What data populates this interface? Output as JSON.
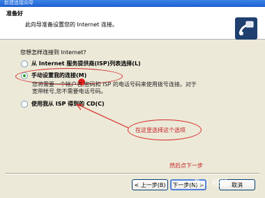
{
  "window": {
    "title": "新建连接向导"
  },
  "header": {
    "title": "准备好",
    "subtitle": "此向导准备设置您的 Internet 连接。",
    "icon": "wizard-connection-icon"
  },
  "question": "您想怎样连接到 Internet?",
  "options": [
    {
      "label": "从 Internet 服务提供商(ISP)列表选择(L)",
      "selected": false
    },
    {
      "label": "手动设置我的连接(M)",
      "selected": true
    },
    {
      "label": "使用我从 ISP 得到的 CD(C)",
      "selected": false
    }
  ],
  "description": [
    "您将需要一个帐户名,密码和 ISP 的电话号码来使用拨号连接。对于",
    "宽带帐号,您不需要电话号码。"
  ],
  "annotations": {
    "select_option": "在这里选择这个选项",
    "then_next": "然后点下一步"
  },
  "buttons": {
    "back": "< 上一步(B)",
    "next": "下一步(N) >",
    "cancel": "取消"
  },
  "watermark": "Bai 经验",
  "colors": {
    "accent": "#d62828",
    "titlebar": "#1c5fd0"
  }
}
